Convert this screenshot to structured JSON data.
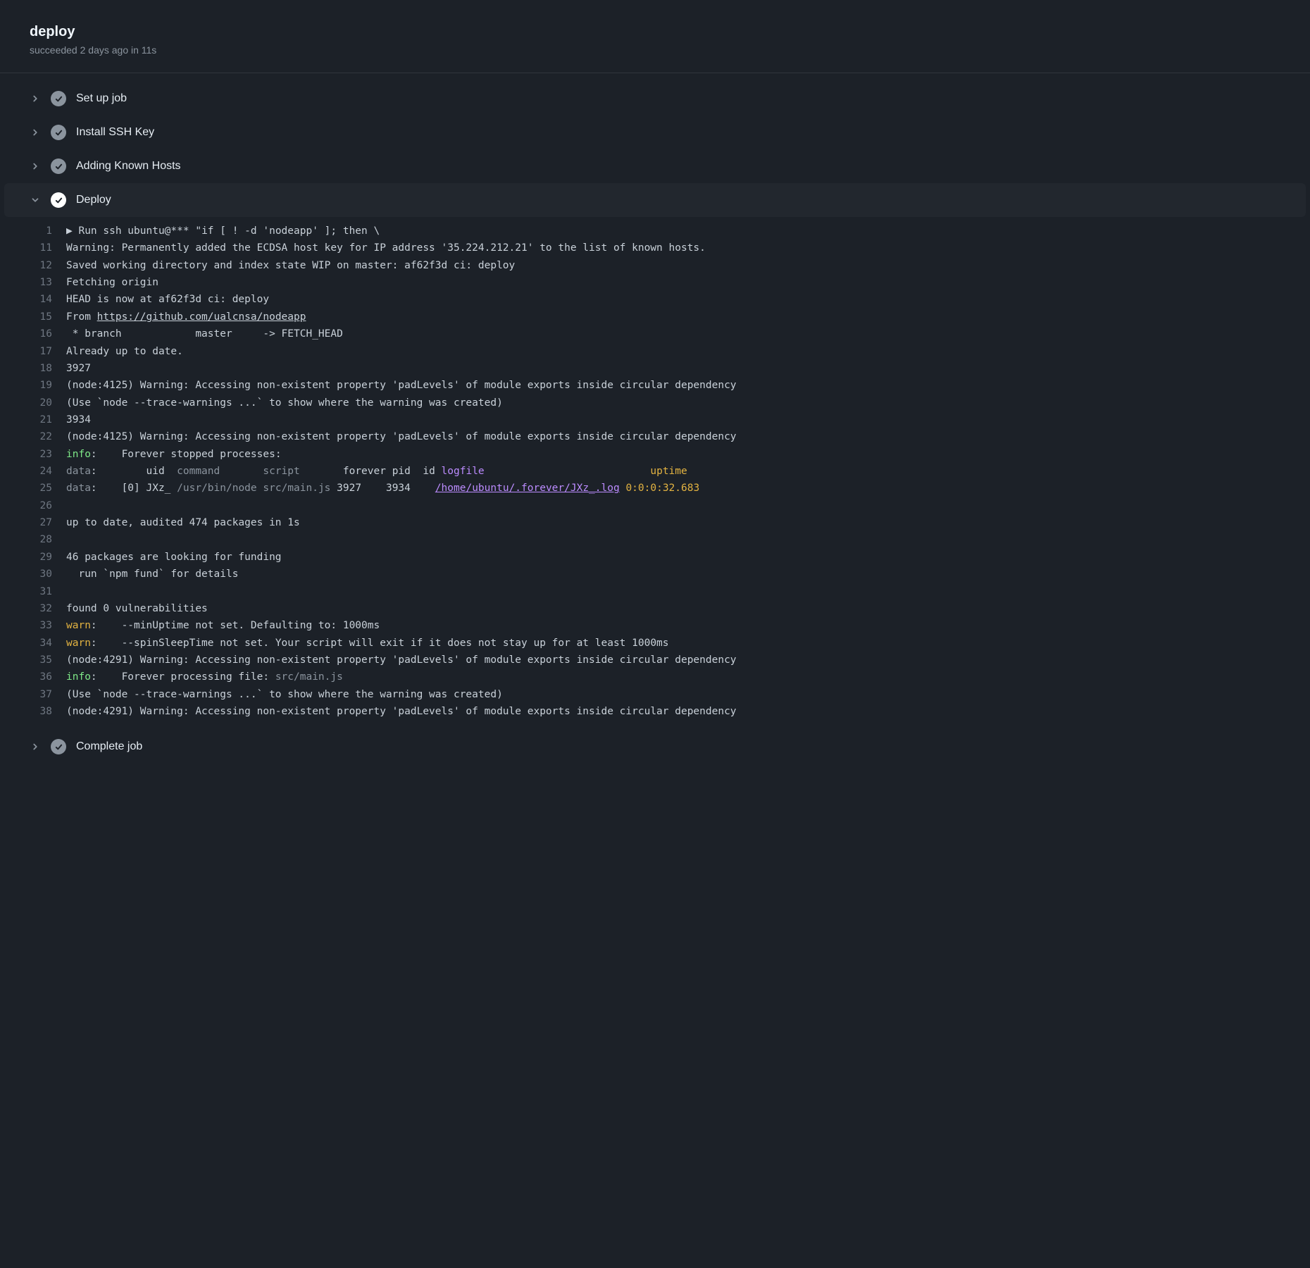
{
  "header": {
    "title": "deploy",
    "subtitle": "succeeded 2 days ago in 11s"
  },
  "steps": [
    {
      "id": "setup",
      "title": "Set up job",
      "expanded": false,
      "status": "success"
    },
    {
      "id": "sshkey",
      "title": "Install SSH Key",
      "expanded": false,
      "status": "success"
    },
    {
      "id": "known",
      "title": "Adding Known Hosts",
      "expanded": false,
      "status": "success"
    },
    {
      "id": "deploy",
      "title": "Deploy",
      "expanded": true,
      "status": "success"
    },
    {
      "id": "complete",
      "title": "Complete job",
      "expanded": false,
      "status": "success"
    }
  ],
  "icons": {
    "chevron-right": "chevron-right-icon",
    "chevron-down": "chevron-down-icon",
    "check": "checkmark-icon"
  },
  "deploy_log": {
    "repo_url": "https://github.com/ualcnsa/nodeapp",
    "lines": [
      {
        "n": 1,
        "kind": "run",
        "text": "Run ssh ubuntu@*** \"if [ ! -d 'nodeapp' ]; then \\"
      },
      {
        "n": 11,
        "kind": "plain",
        "text": "Warning: Permanently added the ECDSA host key for IP address '35.224.212.21' to the list of known hosts."
      },
      {
        "n": 12,
        "kind": "plain",
        "text": "Saved working directory and index state WIP on master: af62f3d ci: deploy"
      },
      {
        "n": 13,
        "kind": "plain",
        "text": "Fetching origin"
      },
      {
        "n": 14,
        "kind": "plain",
        "text": "HEAD is now at af62f3d ci: deploy"
      },
      {
        "n": 15,
        "kind": "from",
        "text": "From ",
        "url": "https://github.com/ualcnsa/nodeapp"
      },
      {
        "n": 16,
        "kind": "plain",
        "text": " * branch            master     -> FETCH_HEAD"
      },
      {
        "n": 17,
        "kind": "plain",
        "text": "Already up to date."
      },
      {
        "n": 18,
        "kind": "plain",
        "text": "3927"
      },
      {
        "n": 19,
        "kind": "plain",
        "text": "(node:4125) Warning: Accessing non-existent property 'padLevels' of module exports inside circular dependency"
      },
      {
        "n": 20,
        "kind": "plain",
        "text": "(Use `node --trace-warnings ...` to show where the warning was created)"
      },
      {
        "n": 21,
        "kind": "plain",
        "text": "3934"
      },
      {
        "n": 22,
        "kind": "plain",
        "text": "(node:4125) Warning: Accessing non-existent property 'padLevels' of module exports inside circular dependency"
      },
      {
        "n": 23,
        "kind": "info",
        "label": "info",
        "rest": ":    Forever stopped processes:"
      },
      {
        "n": 24,
        "kind": "dataheader",
        "label": "data",
        "cols": {
          "uid": "uid",
          "command": "command",
          "script": "script",
          "forever": "forever",
          "pid": "pid",
          "id": "id",
          "logfile": "logfile",
          "uptime": "uptime"
        }
      },
      {
        "n": 25,
        "kind": "datarow",
        "label": "data",
        "row": {
          "idx": "[0]",
          "uid": "JXz_",
          "command": "/usr/bin/node",
          "script": "src/main.js",
          "forever": "3927",
          "pid": "3934",
          "id": "",
          "logfile": "/home/ubuntu/.forever/JXz_.log",
          "uptime": "0:0:0:32.683"
        }
      },
      {
        "n": 26,
        "kind": "plain",
        "text": ""
      },
      {
        "n": 27,
        "kind": "plain",
        "text": "up to date, audited 474 packages in 1s"
      },
      {
        "n": 28,
        "kind": "plain",
        "text": ""
      },
      {
        "n": 29,
        "kind": "plain",
        "text": "46 packages are looking for funding"
      },
      {
        "n": 30,
        "kind": "plain",
        "text": "  run `npm fund` for details"
      },
      {
        "n": 31,
        "kind": "plain",
        "text": ""
      },
      {
        "n": 32,
        "kind": "plain",
        "text": "found 0 vulnerabilities"
      },
      {
        "n": 33,
        "kind": "warn",
        "label": "warn",
        "rest": ":    --minUptime not set. Defaulting to: 1000ms"
      },
      {
        "n": 34,
        "kind": "warn",
        "label": "warn",
        "rest": ":    --spinSleepTime not set. Your script will exit if it does not stay up for at least 1000ms"
      },
      {
        "n": 35,
        "kind": "plain",
        "text": "(node:4291) Warning: Accessing non-existent property 'padLevels' of module exports inside circular dependency"
      },
      {
        "n": 36,
        "kind": "infocmd",
        "label": "info",
        "rest1": ":    Forever processing file: ",
        "cmd": "src/main.js"
      },
      {
        "n": 37,
        "kind": "plain",
        "text": "(Use `node --trace-warnings ...` to show where the warning was created)"
      },
      {
        "n": 38,
        "kind": "plain",
        "text": "(node:4291) Warning: Accessing non-existent property 'padLevels' of module exports inside circular dependency"
      }
    ]
  }
}
